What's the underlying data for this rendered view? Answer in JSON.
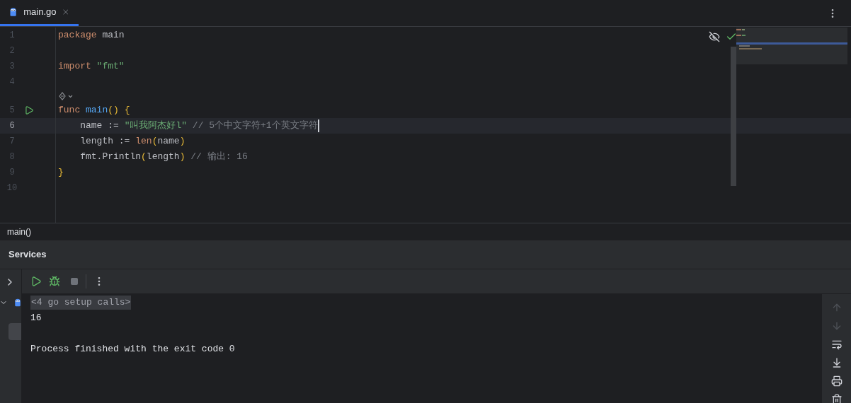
{
  "tabs": [
    {
      "label": "main.go",
      "selected": true
    }
  ],
  "editor": {
    "lines": [
      {
        "kind": "code",
        "number": "1",
        "current": false,
        "run": false,
        "tokens": [
          {
            "t": "package",
            "kind": "keyword"
          },
          {
            "t": " main",
            "kind": "plain"
          }
        ]
      },
      {
        "kind": "code",
        "number": "2",
        "current": false,
        "run": false
      },
      {
        "kind": "code",
        "number": "3",
        "current": false,
        "run": false,
        "tokens": [
          {
            "t": "import",
            "kind": "keyword"
          },
          {
            "t": " \"fmt\"",
            "kind": "string"
          }
        ]
      },
      {
        "kind": "code",
        "number": "4",
        "current": false,
        "run": false
      },
      {
        "kind": "hint"
      },
      {
        "kind": "code",
        "number": "5",
        "current": false,
        "run": true,
        "tokens": [
          {
            "t": "func ",
            "kind": "keyword"
          },
          {
            "t": "main",
            "kind": "function"
          },
          {
            "t": "() {",
            "kind": "bracket"
          }
        ]
      },
      {
        "kind": "code",
        "number": "6",
        "current": true,
        "run": false,
        "tokens": [
          {
            "t": "    name := ",
            "kind": "plain"
          },
          {
            "t": "\"叫我阿杰好l\"",
            "kind": "string"
          },
          {
            "t": " // 5个中文字符+1个英文字符",
            "kind": "comment"
          }
        ]
      },
      {
        "kind": "code",
        "number": "7",
        "current": false,
        "run": false,
        "tokens": [
          {
            "t": "    length := ",
            "kind": "plain"
          },
          {
            "t": "len",
            "kind": "keyword"
          },
          {
            "t": "(",
            "kind": "bracket"
          },
          {
            "t": "name",
            "kind": "plain"
          },
          {
            "t": ")",
            "kind": "bracket"
          }
        ]
      },
      {
        "kind": "code",
        "number": "8",
        "current": false,
        "run": false,
        "tokens": [
          {
            "t": "    fmt.Println",
            "kind": "plain"
          },
          {
            "t": "(",
            "kind": "bracket"
          },
          {
            "t": "length",
            "kind": "plain"
          },
          {
            "t": ")",
            "kind": "bracket"
          },
          {
            "t": " // 输出: 16",
            "kind": "comment"
          }
        ]
      },
      {
        "kind": "code",
        "number": "9",
        "current": false,
        "run": false,
        "tokens": [
          {
            "t": "}",
            "kind": "bracket"
          }
        ]
      },
      {
        "kind": "code",
        "number": "10",
        "current": false,
        "run": false
      }
    ]
  },
  "breadcrumb": "main()",
  "services": {
    "title": "Services",
    "console": [
      {
        "kind": "folded",
        "text": "<4 go setup calls>"
      },
      {
        "kind": "output",
        "text": "16"
      },
      {
        "kind": "blank"
      },
      {
        "kind": "output",
        "text": "Process finished with the exit code 0"
      }
    ],
    "side_tools": [
      {
        "kind": "up",
        "disabled": true
      },
      {
        "kind": "down",
        "disabled": true
      },
      {
        "kind": "wrap",
        "disabled": false
      },
      {
        "kind": "scroll-end",
        "disabled": false
      },
      {
        "kind": "print",
        "disabled": false
      },
      {
        "kind": "trash",
        "disabled": false
      }
    ]
  }
}
